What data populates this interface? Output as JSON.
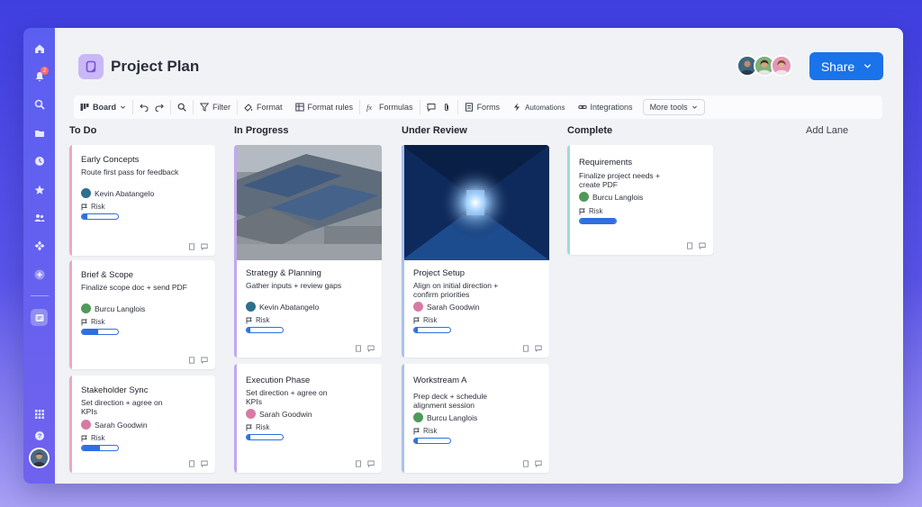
{
  "sidebar": {
    "notification_count": "2",
    "icons": [
      "home-icon",
      "bell-icon",
      "search-icon",
      "folder-icon",
      "clock-icon",
      "star-icon",
      "people-icon",
      "apps-icon",
      "plus-icon",
      "workspace-icon",
      "grid-icon",
      "help-icon"
    ]
  },
  "header": {
    "title": "Project Plan",
    "share_label": "Share"
  },
  "toolbar": {
    "board_label": "Board",
    "filter_label": "Filter",
    "format_label": "Format",
    "format_rules_label": "Format rules",
    "formulas_label": "Formulas",
    "forms_label": "Forms",
    "automations_label": "Automations",
    "integrations_label": "Integrations",
    "more_tools_label": "More tools"
  },
  "add_lane_label": "Add Lane",
  "lanes": [
    {
      "title": "To Do",
      "color": "#f2a6c4",
      "cards": [
        {
          "title": "Early Concepts",
          "desc": "Route first pass for feedback",
          "person": "Kevin Abatangelo",
          "risk": "Risk",
          "progress": 0.15
        },
        {
          "title": "Brief & Scope",
          "desc": "Finalize scope doc + send PDF",
          "person": "Burcu Langlois",
          "risk": "Risk",
          "progress": 0.45
        },
        {
          "title": "Stakeholder Sync",
          "desc": "Set direction + agree on KPIs",
          "person": "Sarah Goodwin",
          "risk": "Risk",
          "progress": 0.5
        }
      ]
    },
    {
      "title": "In Progress",
      "color": "#c2a8ee",
      "cards": [
        {
          "title": "Strategy & Planning",
          "desc": "Gather inputs + review gaps",
          "person": "Kevin Abatangelo",
          "risk": "Risk",
          "progress": 0.1
        },
        {
          "title": "Execution Phase",
          "desc": "Set direction + agree on KPIs",
          "person": "Sarah Goodwin",
          "risk": "Risk",
          "progress": 0.1
        }
      ]
    },
    {
      "title": "Under Review",
      "color": "#a9c0f2",
      "cards": [
        {
          "title": "Project Setup",
          "desc": "Align on initial direction + confirm priorities",
          "person": "Sarah Goodwin",
          "risk": "Risk",
          "progress": 0.1
        },
        {
          "title": "Workstream A",
          "desc": "Prep deck + schedule alignment session",
          "person": "Burcu Langlois",
          "risk": "Risk",
          "progress": 0.1
        }
      ]
    },
    {
      "title": "Complete",
      "color": "#9fdcd3",
      "cards": [
        {
          "title": "Requirements",
          "desc": "Finalize project needs + create PDF",
          "person": "Burcu Langlois",
          "risk": "Risk",
          "progress": 1.0
        }
      ]
    }
  ],
  "colors": {
    "accent": "#1a73e8",
    "progress": "#2f6fe0",
    "kevin": "#2e6f8e",
    "burcu": "#4f9a5a",
    "sarah": "#d77aa6"
  }
}
